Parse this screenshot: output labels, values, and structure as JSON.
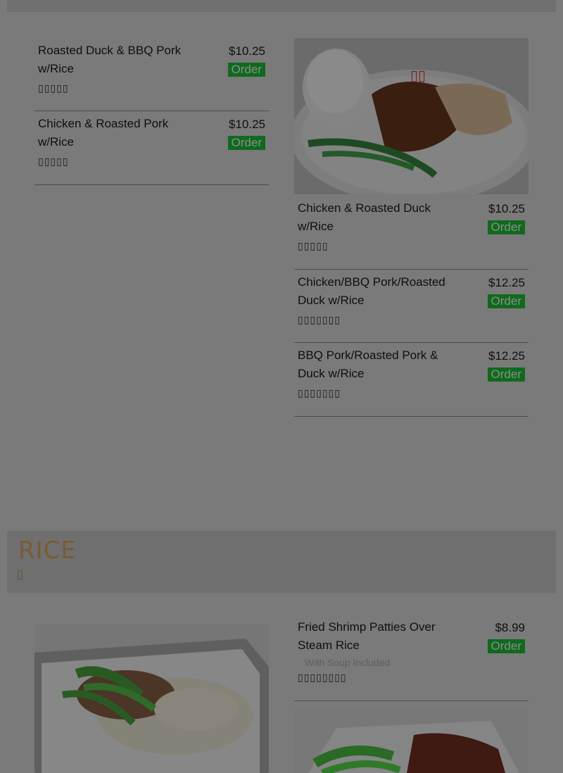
{
  "top_section": {
    "left_items": [
      {
        "name": "Roasted Duck & BBQ Pork w/Rice",
        "chinese": "▯▯▯▯▯",
        "price": "$10.25",
        "order_label": "Order"
      },
      {
        "name": "Chicken & Roasted Pork w/Rice",
        "chinese": "▯▯▯▯▯",
        "price": "$10.25",
        "order_label": "Order"
      }
    ],
    "right_items": [
      {
        "name": "Chicken & Roasted Duck w/Rice",
        "chinese": "▯▯▯▯▯",
        "price": "$10.25",
        "order_label": "Order"
      },
      {
        "name": "Chicken/BBQ Pork/Roasted Duck w/Rice",
        "chinese": "▯▯▯▯▯▯▯",
        "price": "$12.25",
        "order_label": "Order"
      },
      {
        "name": "BBQ Pork/Roasted Pork & Duck w/Rice",
        "chinese": "▯▯▯▯▯▯▯",
        "price": "$12.25",
        "order_label": "Order"
      }
    ]
  },
  "rice_section": {
    "title": "RICE",
    "glyph": "▯",
    "items": [
      {
        "name": "Fried Shrimp Patties Over Steam Rice",
        "note": "With Soup Included",
        "chinese": "▯▯▯▯▯▯▯▯",
        "price": "$8.99",
        "order_label": "Order"
      }
    ]
  },
  "colors": {
    "overlay": "#7a7a7a",
    "order_button": "#0f6a1d",
    "section_title": "#7a5a34"
  }
}
